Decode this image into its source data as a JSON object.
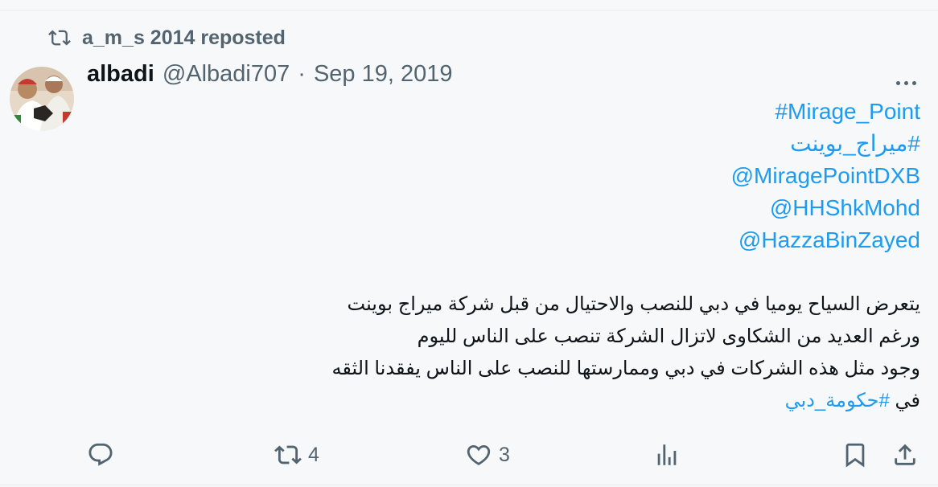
{
  "repost": {
    "icon": "repost-icon",
    "text": "a_m_s 2014 reposted"
  },
  "tweet": {
    "avatar": "avatar",
    "name": "albadi",
    "handle": "@Albadi707",
    "separator": "·",
    "date": "Sep 19, 2019",
    "more_icon": "more-icon",
    "lines": {
      "l1": "#Mirage_Point",
      "l2": "#ميراج_بوينت",
      "l3": "@MiragePointDXB",
      "l4": "@HHShkMohd",
      "l5": "@HazzaBinZayed",
      "l6": "يتعرض السياح يوميا في دبي للنصب والاحتيال من قبل شركة ميراج بوينت",
      "l7": "ورغم العديد من الشكاوى لاتزال الشركة تنصب على الناس لليوم",
      "l8": "وجود مثل هذه الشركات في دبي وممارستها للنصب على الناس يفقدنا الثقه",
      "l9_prefix": "في",
      "l9_tag": "#حكومة_دبي"
    },
    "link_color": "#1d9bf0",
    "text_color": "#0f1419",
    "muted_color": "#536471"
  },
  "actions": {
    "reply": {
      "icon": "reply-icon",
      "count": ""
    },
    "repost": {
      "icon": "repost-icon",
      "count": "4"
    },
    "like": {
      "icon": "heart-icon",
      "count": "3"
    },
    "views": {
      "icon": "analytics-icon",
      "count": ""
    },
    "bookmark": {
      "icon": "bookmark-icon"
    },
    "share": {
      "icon": "share-icon"
    }
  }
}
